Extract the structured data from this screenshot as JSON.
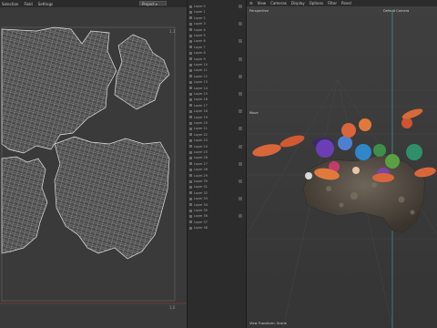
{
  "uv_editor": {
    "menu": [
      "Selection",
      "Field",
      "Settings"
    ],
    "dropdown": "Project",
    "corner_labels": {
      "top_left": "0,1",
      "top_right": "1,1",
      "bottom_left": "0,0",
      "bottom_right": "1,0"
    }
  },
  "side_panel": {
    "rows": [
      "Layer 0",
      "Layer 1",
      "Layer 2",
      "Layer 3",
      "Layer 4",
      "Layer 5",
      "Layer 6",
      "Layer 7",
      "Layer 8",
      "Layer 9",
      "Layer 10",
      "Layer 11",
      "Layer 12",
      "Layer 13",
      "Layer 14",
      "Layer 15",
      "Layer 16",
      "Layer 17",
      "Layer 18",
      "Layer 19",
      "Layer 20",
      "Layer 21",
      "Layer 22",
      "Layer 23",
      "Layer 24",
      "Layer 25",
      "Layer 26",
      "Layer 27",
      "Layer 28",
      "Layer 29",
      "Layer 30",
      "Layer 31",
      "Layer 32",
      "Layer 33",
      "Layer 34",
      "Layer 35",
      "Layer 36",
      "Layer 37",
      "Layer 38"
    ]
  },
  "viewport": {
    "menu": [
      "View",
      "Cameras",
      "Display",
      "Options",
      "Filter",
      "Panel"
    ],
    "camera_label": "Perspective",
    "default_camera": "Default Camera",
    "move_label": "Move",
    "bottom_label": "View Transform: Scene"
  },
  "colors": {
    "wire": "#d8d8d8",
    "accent": "#4aa3a3",
    "coral_orange": "#d9663a",
    "coral_purple": "#6b3fb3",
    "coral_blue": "#2f86c9",
    "coral_green": "#3f8f4a",
    "rock": "#585045"
  }
}
